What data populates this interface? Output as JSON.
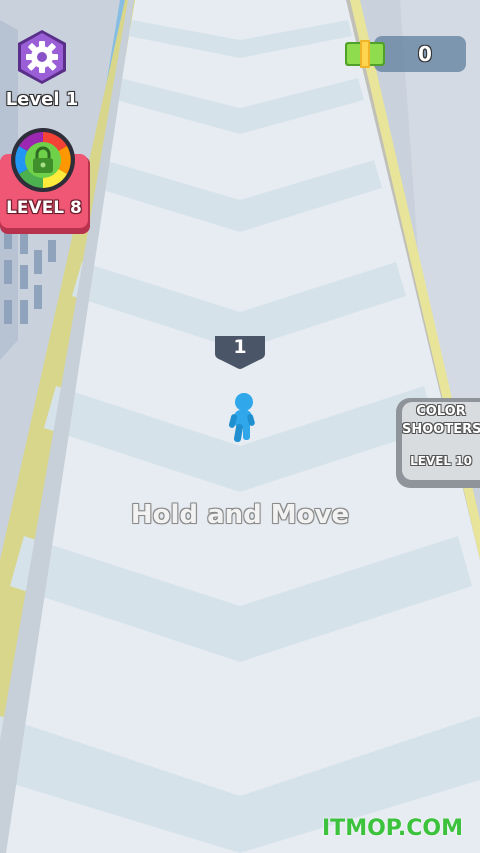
{
  "hud": {
    "level_label": "Level 1",
    "next_unlock_label": "LEVEL 8",
    "cash_value": "0"
  },
  "game": {
    "crowd_count": "1",
    "hint_text": "Hold and Move"
  },
  "promo": {
    "line1": "COLOR",
    "line2": "SHOOTERS",
    "line3": "LEVEL 10"
  },
  "watermark": "ITMOP.COM",
  "icons": {
    "settings": "gear-icon",
    "unlock": "padlock-icon",
    "cash": "cash-bill-icon"
  },
  "colors": {
    "player": "#2fa7ea",
    "settings_badge": "#8a52c8",
    "unlock_card": "#ec4f6c",
    "cash_bill": "#7ed34a",
    "watermark": "#3cc23c"
  }
}
